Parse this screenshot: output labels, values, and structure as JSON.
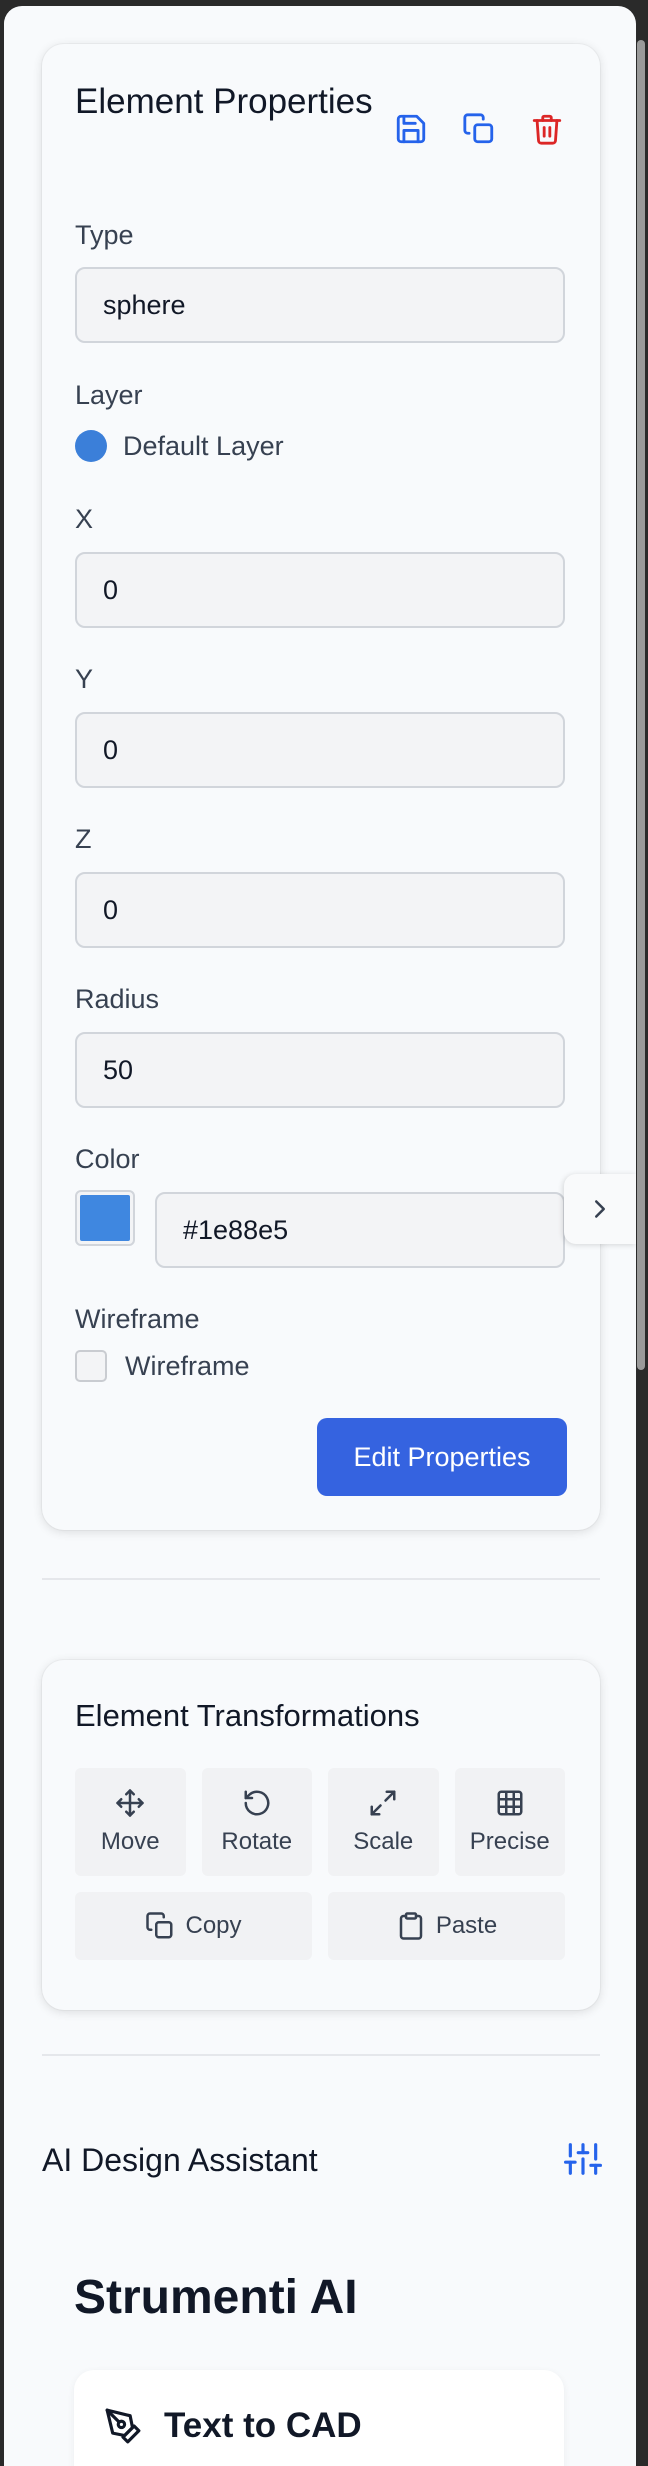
{
  "properties_panel": {
    "title": "Element Properties",
    "fields": {
      "type": {
        "label": "Type",
        "value": "sphere"
      },
      "layer": {
        "label": "Layer",
        "value": "Default Layer",
        "color": "#3b7fd9"
      },
      "x": {
        "label": "X",
        "value": "0"
      },
      "y": {
        "label": "Y",
        "value": "0"
      },
      "z": {
        "label": "Z",
        "value": "0"
      },
      "radius": {
        "label": "Radius",
        "value": "50"
      },
      "color": {
        "label": "Color",
        "value": "#1e88e5",
        "swatch": "#3f87e0"
      },
      "wireframe": {
        "label": "Wireframe",
        "checkbox_label": "Wireframe",
        "checked": false
      }
    },
    "edit_button": "Edit Properties",
    "icons": [
      "save-icon",
      "duplicate-icon",
      "trash-icon"
    ]
  },
  "transformations": {
    "title": "Element Transformations",
    "tools": [
      {
        "label": "Move",
        "icon": "move-icon"
      },
      {
        "label": "Rotate",
        "icon": "rotate-icon"
      },
      {
        "label": "Scale",
        "icon": "scale-icon"
      },
      {
        "label": "Precise",
        "icon": "grid-icon"
      }
    ],
    "copy": "Copy",
    "paste": "Paste"
  },
  "ai_assistant": {
    "title": "AI Design Assistant",
    "brand": "Strumenti AI",
    "feature_card": "Text to CAD"
  },
  "colors": {
    "accent": "#3563e0",
    "danger": "#dc2626"
  }
}
